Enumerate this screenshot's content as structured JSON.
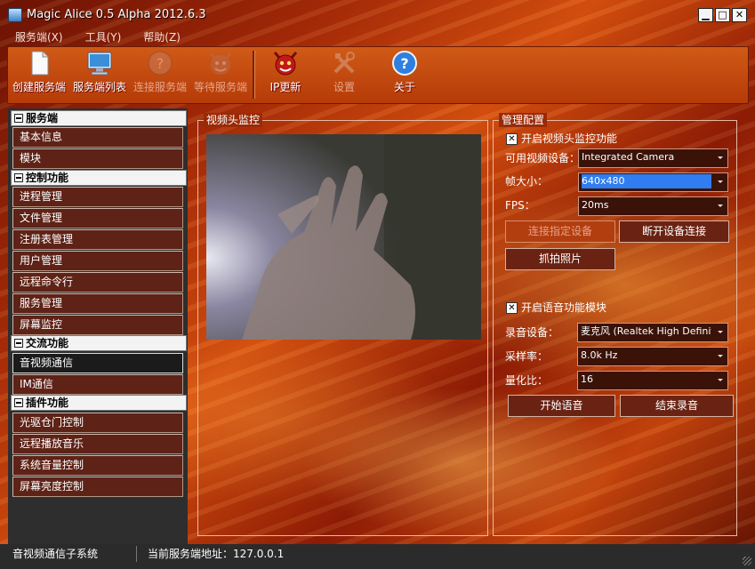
{
  "window": {
    "title": "Magic Alice 0.5 Alpha 2012.6.3",
    "minimize": "▁",
    "maximize": "□",
    "close": "✕"
  },
  "menu": [
    "服务端(X)",
    "工具(Y)",
    "帮助(Z)"
  ],
  "toolbar": [
    {
      "label": "创建服务端",
      "icon": "document-icon",
      "enabled": true
    },
    {
      "label": "服务端列表",
      "icon": "monitor-icon",
      "enabled": true
    },
    {
      "label": "连接服务端",
      "icon": "question-icon",
      "enabled": false
    },
    {
      "label": "等待服务端",
      "icon": "devil-icon",
      "enabled": false
    },
    {
      "label": "IP更新",
      "icon": "devil-icon",
      "enabled": true
    },
    {
      "label": "设置",
      "icon": "tools-icon",
      "enabled": false
    },
    {
      "label": "关于",
      "icon": "help-icon",
      "enabled": true
    }
  ],
  "sidebar": {
    "sections": [
      {
        "title": "服务端",
        "items": [
          "基本信息",
          "模块"
        ]
      },
      {
        "title": "控制功能",
        "items": [
          "进程管理",
          "文件管理",
          "注册表管理",
          "用户管理",
          "远程命令行",
          "服务管理",
          "屏幕监控"
        ]
      },
      {
        "title": "交流功能",
        "items": [
          "音视频通信",
          "IM通信"
        ]
      },
      {
        "title": "插件功能",
        "items": [
          "光驱仓门控制",
          "远程播放音乐",
          "系统音量控制",
          "屏幕亮度控制"
        ]
      }
    ],
    "active_item": "音视频通信"
  },
  "video_pane": {
    "title": "视频头监控"
  },
  "config": {
    "title": "管理配置",
    "camera_enable": {
      "label": "开启视频头监控功能",
      "checked": true
    },
    "device_label": "可用视频设备：",
    "device_value": "Integrated Camera",
    "frame_label": "帧大小：",
    "frame_value": "640x480",
    "fps_label": "FPS：",
    "fps_value": "20ms",
    "connect_btn": "连接指定设备",
    "disconnect_btn": "断开设备连接",
    "snapshot_btn": "抓拍照片",
    "voice_enable": {
      "label": "开启语音功能模块",
      "checked": true
    },
    "rec_label": "录音设备：",
    "rec_value": "麦克风 (Realtek High Definition",
    "rate_label": "采样率：",
    "rate_value": "8.0k Hz",
    "bits_label": "量化比：",
    "bits_value": "16",
    "start_voice_btn": "开始语音",
    "stop_rec_btn": "结束录音"
  },
  "status": {
    "left": "音视频通信子系统",
    "right": "当前服务端地址：127.0.0.1"
  }
}
